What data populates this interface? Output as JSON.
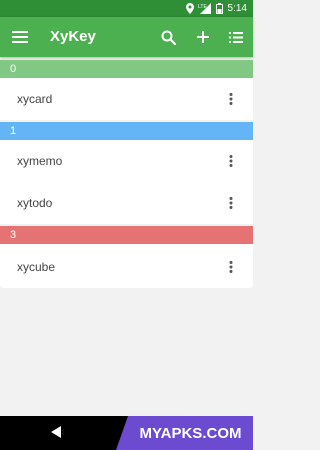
{
  "status_bar": {
    "time": "5:14",
    "network": "LTE"
  },
  "app_bar": {
    "title": "XyKey"
  },
  "sections": [
    {
      "label": "0",
      "color": "#80c883"
    },
    {
      "label": "1",
      "color": "#64b5f6"
    },
    {
      "label": "3",
      "color": "#e57373"
    }
  ],
  "items": [
    {
      "name": "xycard"
    },
    {
      "name": "xymemo"
    },
    {
      "name": "xytodo"
    },
    {
      "name": "xycube"
    }
  ],
  "watermark": {
    "text": "MYAPKS.COM"
  },
  "colors": {
    "status_bar": "#2e8f36",
    "app_bar": "#4caf50",
    "watermark": "#6c4bd0"
  }
}
